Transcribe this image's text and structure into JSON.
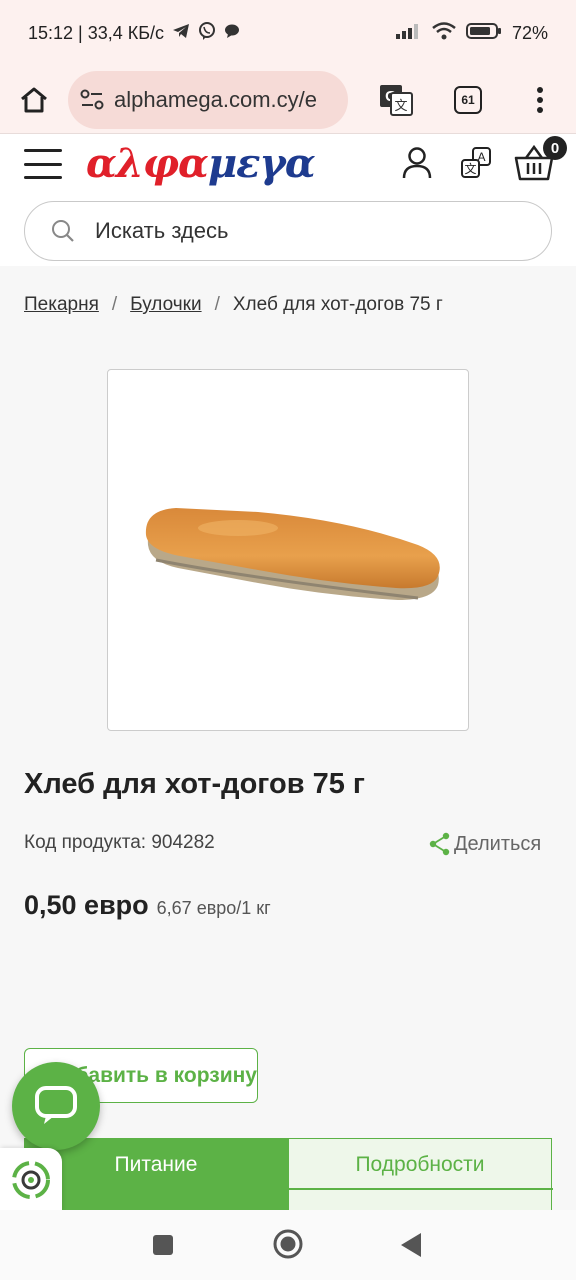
{
  "status_bar": {
    "time_speed": "15:12 | 33,4 КБ/с",
    "battery": "72%"
  },
  "browser": {
    "url": "alphamega.com.cy/e",
    "tab_count": "61"
  },
  "site": {
    "logo_red_1": "αλ",
    "logo_red_2": "φα",
    "logo_blue": "μεγα",
    "cart_count": "0",
    "search_placeholder": "Искать здесь"
  },
  "breadcrumb": {
    "items": [
      "Пекарня",
      "Булочки"
    ],
    "current": "Хлеб для хот-догов 75 г",
    "separator": "/"
  },
  "product": {
    "title": "Хлеб для хот-догов 75 г",
    "code": "Код продукта: 904282",
    "share_label": "Делиться",
    "price": "0,50 евро",
    "unit_price": "6,67 евро/1 кг",
    "add_to_cart_label": "Добавить в корзину"
  },
  "tabs": [
    {
      "label": "Питание",
      "active": true
    },
    {
      "label": "Подробности",
      "active": false
    }
  ],
  "colors": {
    "brand_green": "#5cb246",
    "brand_red": "#e0202a",
    "brand_blue": "#1e3b8f"
  }
}
